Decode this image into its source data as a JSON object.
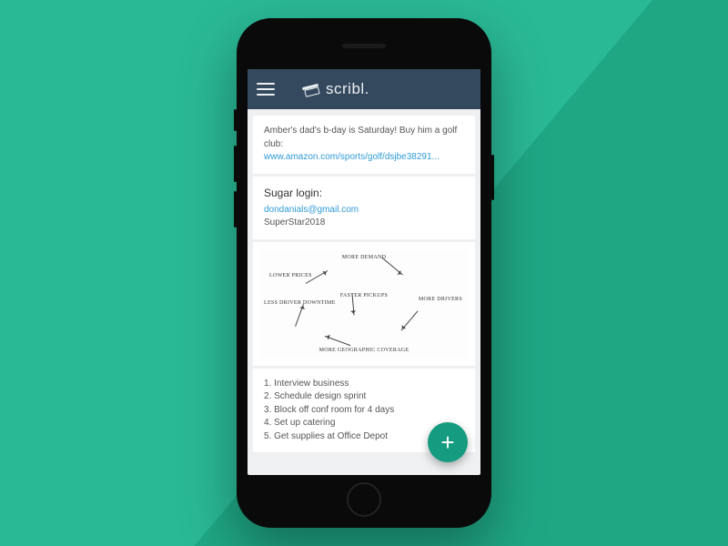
{
  "app": {
    "name": "scribl."
  },
  "notes": {
    "note1": {
      "text": "Amber's dad's b-day is Saturday! Buy him a golf club:",
      "link": "www.amazon.com/sports/golf/dsjbe38291..."
    },
    "note2": {
      "title": "Sugar login:",
      "email": "dondanials@gmail.com",
      "password": "SuperStar2018"
    },
    "note3": {
      "nodes": {
        "top": "MORE DEMAND",
        "right": "MORE DRIVERS",
        "bottom": "MORE GEOGRAPHIC COVERAGE",
        "left": "LESS DRIVER DOWNTIME",
        "upperleft": "LOWER PRICES",
        "center": "FASTER PICKUPS"
      }
    },
    "note4": {
      "items": [
        "Interview business",
        "Schedule design sprint",
        "Block off conf room for 4 days",
        "Set up catering",
        "Get supplies at Office Depot"
      ]
    }
  },
  "fab": {
    "label": "+"
  }
}
